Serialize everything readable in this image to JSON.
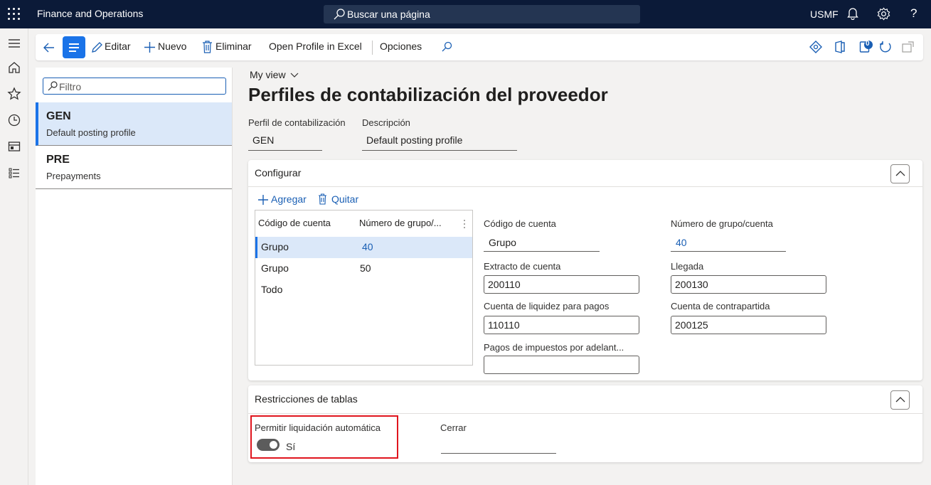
{
  "topbar": {
    "app_name": "Finance and Operations",
    "search_placeholder": "Buscar una página",
    "company": "USMF",
    "help_label": "?"
  },
  "actions": {
    "edit": "Editar",
    "new": "Nuevo",
    "delete": "Eliminar",
    "open_excel": "Open Profile in Excel",
    "options": "Opciones",
    "notification_count": "0"
  },
  "list": {
    "filter_placeholder": "Filtro",
    "items": [
      {
        "title": "GEN",
        "subtitle": "Default posting profile",
        "selected": true
      },
      {
        "title": "PRE",
        "subtitle": "Prepayments",
        "selected": false
      }
    ]
  },
  "main": {
    "view_label": "My view",
    "page_title": "Perfiles de contabilización del proveedor",
    "header_fields": {
      "profile_label": "Perfil de contabilización",
      "profile_value": "GEN",
      "description_label": "Descripción",
      "description_value": "Default posting profile"
    }
  },
  "setup": {
    "title": "Configurar",
    "add_label": "Agregar",
    "remove_label": "Quitar",
    "grid": {
      "columns": [
        "Código de cuenta",
        "Número de grupo/..."
      ],
      "rows": [
        {
          "account_code": "Grupo",
          "group_number": "40"
        },
        {
          "account_code": "Grupo",
          "group_number": "50"
        },
        {
          "account_code": "Todo",
          "group_number": ""
        }
      ]
    },
    "details": {
      "account_code_label": "Código de cuenta",
      "account_code_value": "Grupo",
      "group_number_label": "Número de grupo/cuenta",
      "group_number_value": "40",
      "summary_label": "Extracto de cuenta",
      "summary_value": "200110",
      "arrival_label": "Llegada",
      "arrival_value": "200130",
      "liquidity_label": "Cuenta de liquidez para pagos",
      "liquidity_value": "110110",
      "offset_label": "Cuenta de contrapartida",
      "offset_value": "200125",
      "prepayment_tax_label": "Pagos de impuestos por adelant...",
      "prepayment_tax_value": ""
    }
  },
  "restrictions": {
    "title": "Restricciones de tablas",
    "auto_settle_label": "Permitir liquidación automática",
    "auto_settle_value": "Sí",
    "auto_settle_on": true,
    "close_label": "Cerrar",
    "close_value": ""
  },
  "colors": {
    "navbar": "#0b1a38",
    "accent": "#1a73e8",
    "highlight": "#e0151e"
  }
}
